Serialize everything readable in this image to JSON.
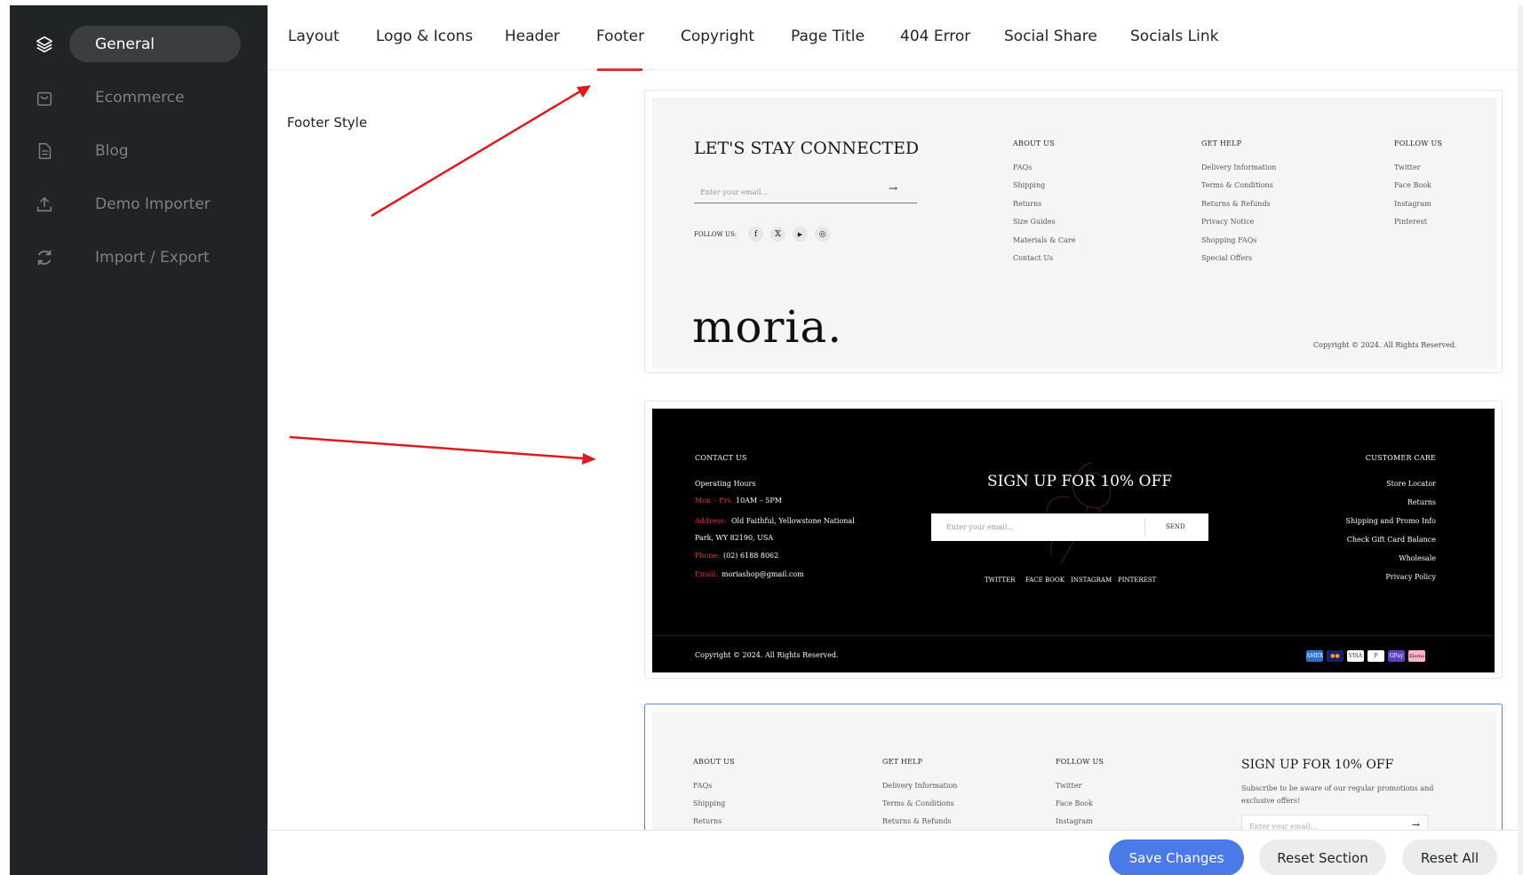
{
  "sidebar": {
    "items": [
      {
        "label": "General",
        "icon": "layers-icon",
        "active": true
      },
      {
        "label": "Ecommerce",
        "icon": "shopping-bag-icon"
      },
      {
        "label": "Blog",
        "icon": "document-icon"
      },
      {
        "label": "Demo Importer",
        "icon": "upload-icon"
      },
      {
        "label": "Import / Export",
        "icon": "refresh-icon"
      }
    ]
  },
  "tabs": [
    "Layout",
    "Logo & Icons",
    "Header",
    "Footer",
    "Copyright",
    "Page Title",
    "404 Error",
    "Social Share",
    "Socials Link"
  ],
  "active_tab": "Footer",
  "field": {
    "label": "Footer Style"
  },
  "footer1": {
    "heading": "LET'S STAY CONNECTED",
    "email_placeholder": "Enter your email...",
    "arrow": "→",
    "follow_label": "FOLLOW US:",
    "social_icons": [
      "f",
      "𝕏",
      "▶",
      "◎"
    ],
    "col1": {
      "title": "ABOUT US",
      "links": [
        "FAQs",
        "Shipping",
        "Returns",
        "Size Guides",
        "Materials & Care",
        "Contact Us"
      ]
    },
    "col2": {
      "title": "GET HELP",
      "links": [
        "Delivery Information",
        "Terms & Conditions",
        "Returns & Refunds",
        "Privacy Notice",
        "Shopping FAQs",
        "Special Offers"
      ]
    },
    "col3": {
      "title": "FOLLOW US",
      "links": [
        "Twitter",
        "Face Book",
        "Instagram",
        "Pinterest"
      ]
    },
    "logo": "moria.",
    "copyright": "Copyright © 2024. All Rights Reserved."
  },
  "footer2": {
    "contact_title": "CONTACT US",
    "hours_label": "Operating Hours",
    "hours_days": "Mon – Fri:",
    "hours_time": "10AM – 5PM",
    "address_label": "Address:",
    "address_line1": "Old Faithful, Yellowstone National",
    "address_line2": "Park, WY 82190, USA",
    "phone_label": "Phone:",
    "phone": "(02) 6188 8062",
    "email_label": "Email:",
    "email": "moriashop@gmail.com",
    "signup_heading": "SIGN UP FOR 10% OFF",
    "email_placeholder": "Enter your email...",
    "send_label": "SEND",
    "socials": [
      "TWITTER",
      "FACE BOOK",
      "INSTAGRAM",
      "PINTEREST"
    ],
    "care_title": "CUSTOMER CARE",
    "care_links": [
      "Store Locator",
      "Returns",
      "Shipping and Promo Info",
      "Check Gift Card Balance",
      "Wholesale",
      "Privacy Policy"
    ],
    "copyright": "Copyright © 2024. All Rights Reserved.",
    "payments": [
      {
        "label": "AMEX",
        "color": "#2a6fd6"
      },
      {
        "label": "●●",
        "color": "#1a1f71"
      },
      {
        "label": "VISA",
        "color": "#1a1f71"
      },
      {
        "label": "P",
        "color": "#003087"
      },
      {
        "label": "GPay",
        "color": "#5f3dc4"
      },
      {
        "label": "Klarna",
        "color": "#ffb3c7"
      }
    ]
  },
  "footer3": {
    "col1": {
      "title": "ABOUT US",
      "links": [
        "FAQs",
        "Shipping",
        "Returns"
      ]
    },
    "col2": {
      "title": "GET HELP",
      "links": [
        "Delivery Information",
        "Terms & Conditions",
        "Returns & Refunds"
      ]
    },
    "col3": {
      "title": "FOLLOW US",
      "links": [
        "Twitter",
        "Face Book",
        "Instagram"
      ]
    },
    "signup_heading": "SIGN UP FOR 10% OFF",
    "signup_text_1": "Subscribe to be aware of our regular promotions and",
    "signup_text_2": "exclusive offers!",
    "email_placeholder": "Enter your email...",
    "arrow": "→"
  },
  "actions": {
    "save": "Save Changes",
    "reset_section": "Reset Section",
    "reset_all": "Reset All"
  },
  "colors": {
    "accent_red": "#e0312e",
    "primary_blue": "#4a7ae8",
    "sidebar_bg": "#1f2427"
  }
}
